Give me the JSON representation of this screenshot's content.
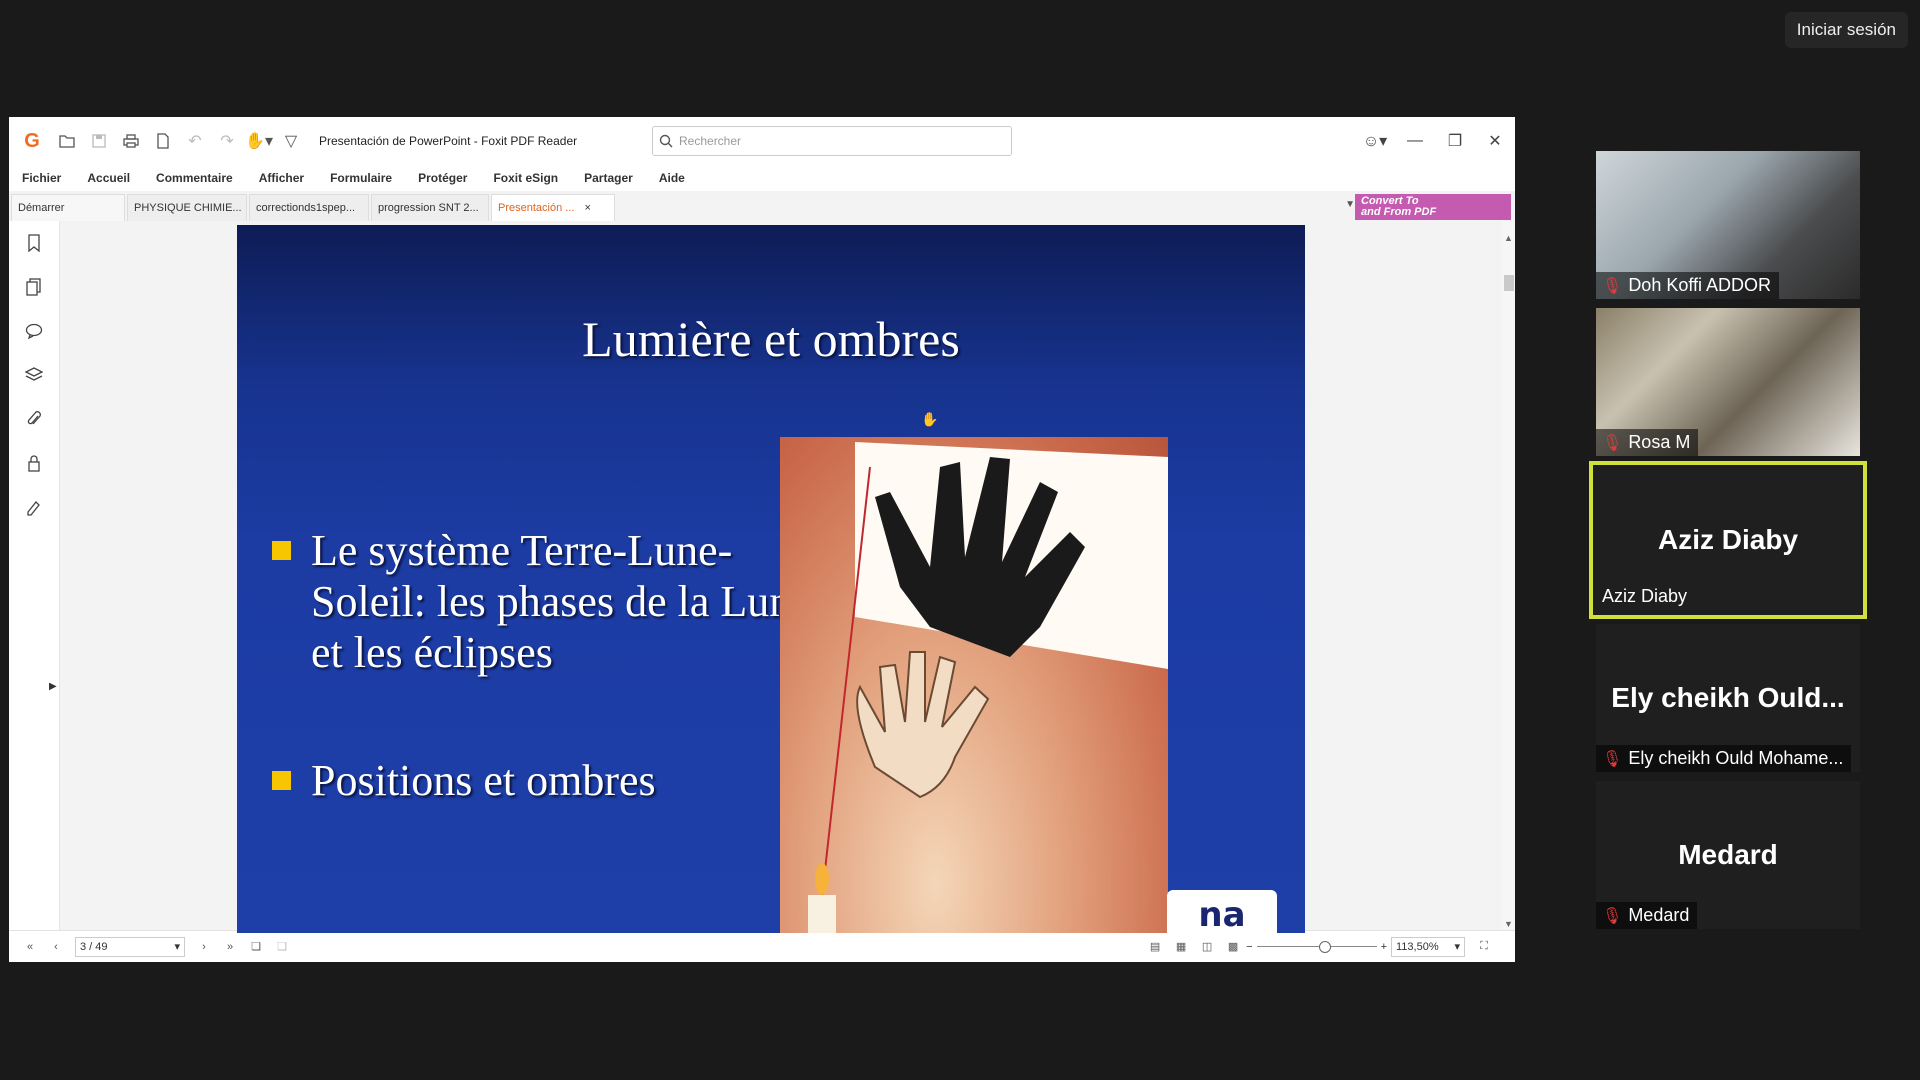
{
  "meeting": {
    "signin_label": "Iniciar sesión"
  },
  "foxit": {
    "window_title": "Presentación de PowerPoint - Foxit PDF Reader",
    "search_placeholder": "Rechercher",
    "menu": [
      "Fichier",
      "Accueil",
      "Commentaire",
      "Afficher",
      "Formulaire",
      "Protéger",
      "Foxit eSign",
      "Partager",
      "Aide"
    ],
    "tabs": [
      "Démarrer",
      "PHYSIQUE CHIMIE...",
      "correctionds1spep...",
      "progression SNT 2...",
      "Presentación ..."
    ],
    "tab_close": "×",
    "convert_banner": {
      "line1": "Convert To",
      "line2": "and From PDF"
    },
    "status": {
      "page_display": "3 / 49",
      "zoom_display": "113,50%"
    }
  },
  "slide": {
    "title": "Lumière et ombres",
    "bullets": [
      "Le système Terre-Lune-Soleil: les phases  de la Lune et les éclipses",
      "Positions et ombres"
    ],
    "logo_text": "na"
  },
  "participants": [
    {
      "name": "Doh Koffi ADDOR",
      "muted": true,
      "video": true
    },
    {
      "name": "Rosa M",
      "muted": true,
      "video": true
    },
    {
      "name": "Aziz Diaby",
      "big_name": "Aziz Diaby",
      "muted": false,
      "video": false,
      "active": true
    },
    {
      "name": "Ely cheikh Ould Mohame...",
      "big_name": "Ely cheikh Ould...",
      "muted": true,
      "video": false
    },
    {
      "name": "Medard",
      "big_name": "Medard",
      "muted": true,
      "video": false
    }
  ],
  "colors": {
    "accent_orange": "#e0641e",
    "slide_blue": "#1e3fa8",
    "bullet_yellow": "#f7c600",
    "active_speaker": "#cfe13a",
    "muted_red": "#e23b3b"
  }
}
